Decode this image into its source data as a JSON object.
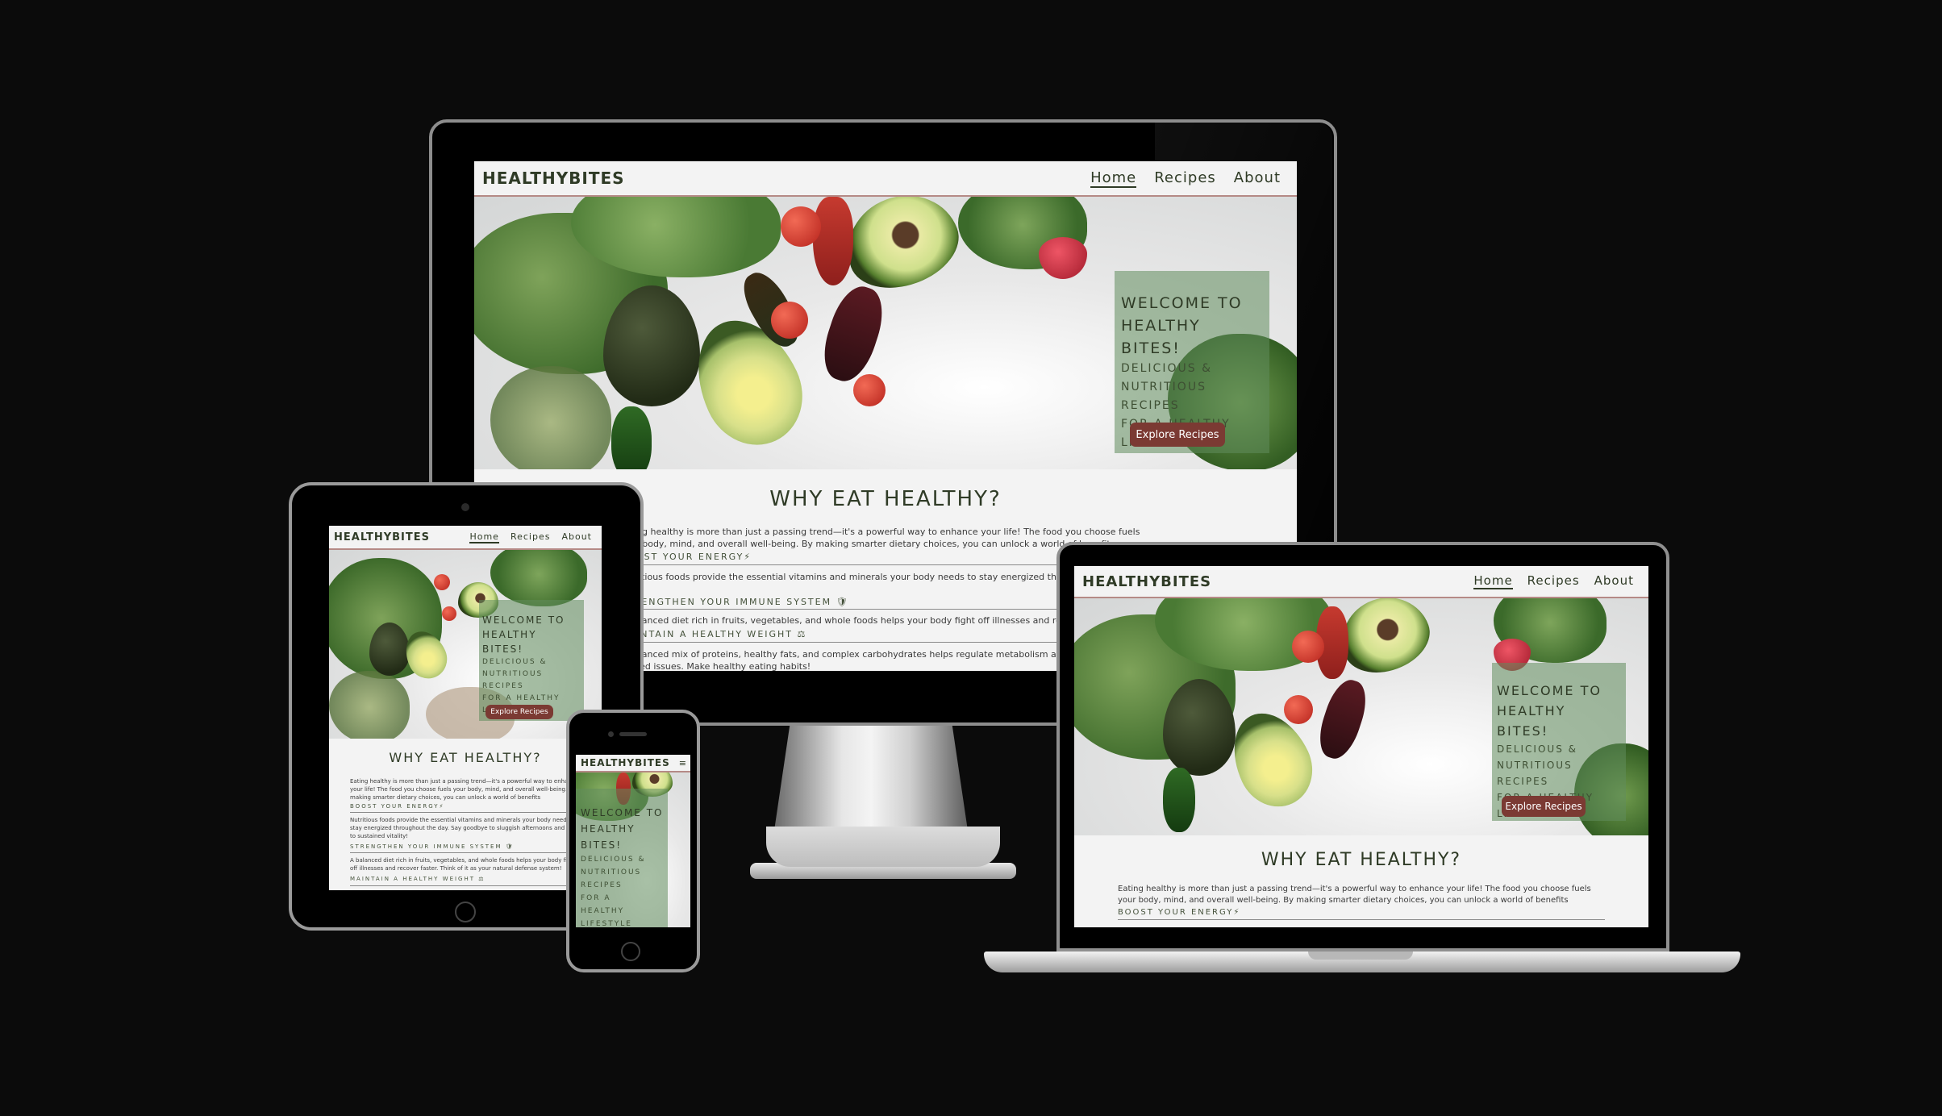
{
  "site": {
    "brand": "HEALTHYBITES",
    "nav": {
      "home": "Home",
      "recipes": "Recipes",
      "about": "About"
    },
    "hero": {
      "heading_line1": "WELCOME TO",
      "heading_line2": "HEALTHY BITES!",
      "sub1": "DELICIOUS &",
      "sub2": "NUTRITIOUS RECIPES",
      "sub3": "FOR A HEALTHY",
      "sub4": "LIFESTYLE",
      "cta": "Explore Recipes"
    },
    "section": {
      "title": "WHY EAT HEALTHY?",
      "intro": "Eating healthy is more than just a passing trend—it's a powerful way to enhance your life! The food you choose fuels your body, mind, and overall well-being. By making smarter dietary choices, you can unlock a world of benefits",
      "boost": "BOOST YOUR ENERGY⚡",
      "boost_text": "Nutritious foods provide the essential vitamins and minerals your body needs to stay energized throughout the day. Say goodbye to sluggish afternoons and hello to sustained vitality!",
      "immune": "STRENGTHEN YOUR IMMUNE SYSTEM 🛡",
      "immune_text": "A balanced diet rich in fruits, vegetables, and whole foods helps your body fight off illnesses and recover faster. Think of it as your natural defense system!",
      "weight": "MAINTAIN A HEALTHY WEIGHT ⚖",
      "weight_text": "A balanced mix of proteins, healthy fats, and complex carbohydrates helps regulate metabolism and prevent weight-related issues. Make healthy eating habits!"
    },
    "mobile_menu_icon": "≡"
  },
  "colors": {
    "background": "#0b0b0b",
    "page": "#f3f3f3",
    "text_dark_green": "#2f3b26",
    "overlay_green": "#608c5c",
    "button": "#7b3a33",
    "nav_border": "#b58a86"
  },
  "icons": {
    "energy": "lightning-icon",
    "immune": "shield-icon",
    "weight": "scale-icon",
    "menu": "hamburger-icon"
  }
}
